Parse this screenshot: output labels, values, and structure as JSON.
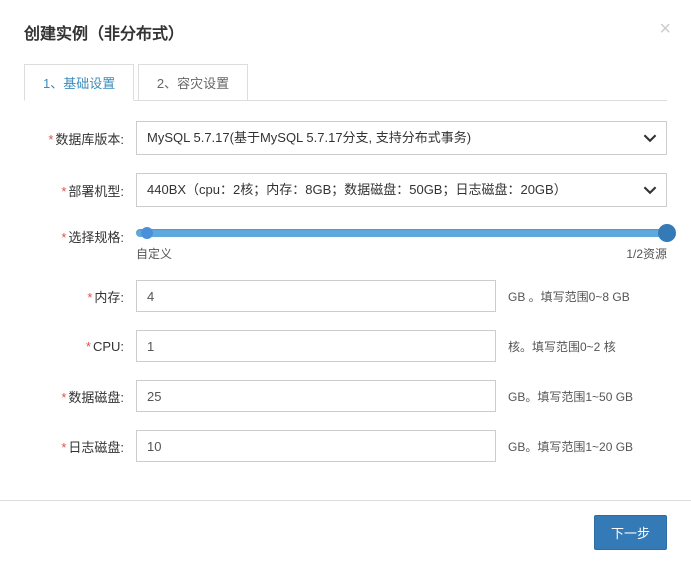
{
  "modal": {
    "title": "创建实例（非分布式）",
    "close": "×"
  },
  "tabs": {
    "basic": "1、基础设置",
    "dr": "2、容灾设置"
  },
  "labels": {
    "db_version": "数据库版本:",
    "deploy_model": "部署机型:",
    "spec": "选择规格:",
    "memory": "内存:",
    "cpu": "CPU:",
    "data_disk": "数据磁盘:",
    "log_disk": "日志磁盘:"
  },
  "values": {
    "db_version": "MySQL 5.7.17(基于MySQL 5.7.17分支, 支持分布式事务)",
    "deploy_model": "440BX（cpu：2核；内存：8GB；数据磁盘：50GB；日志磁盘：20GB）",
    "slider_left": "自定义",
    "slider_right": "1/2资源",
    "memory": "4",
    "cpu": "1",
    "data_disk": "25",
    "log_disk": "10"
  },
  "hints": {
    "memory": "GB 。填写范围0~8 GB",
    "cpu": "核。填写范围0~2 核",
    "data_disk": "GB。填写范围1~50 GB",
    "log_disk": "GB。填写范围1~20 GB"
  },
  "footer": {
    "next": "下一步"
  }
}
